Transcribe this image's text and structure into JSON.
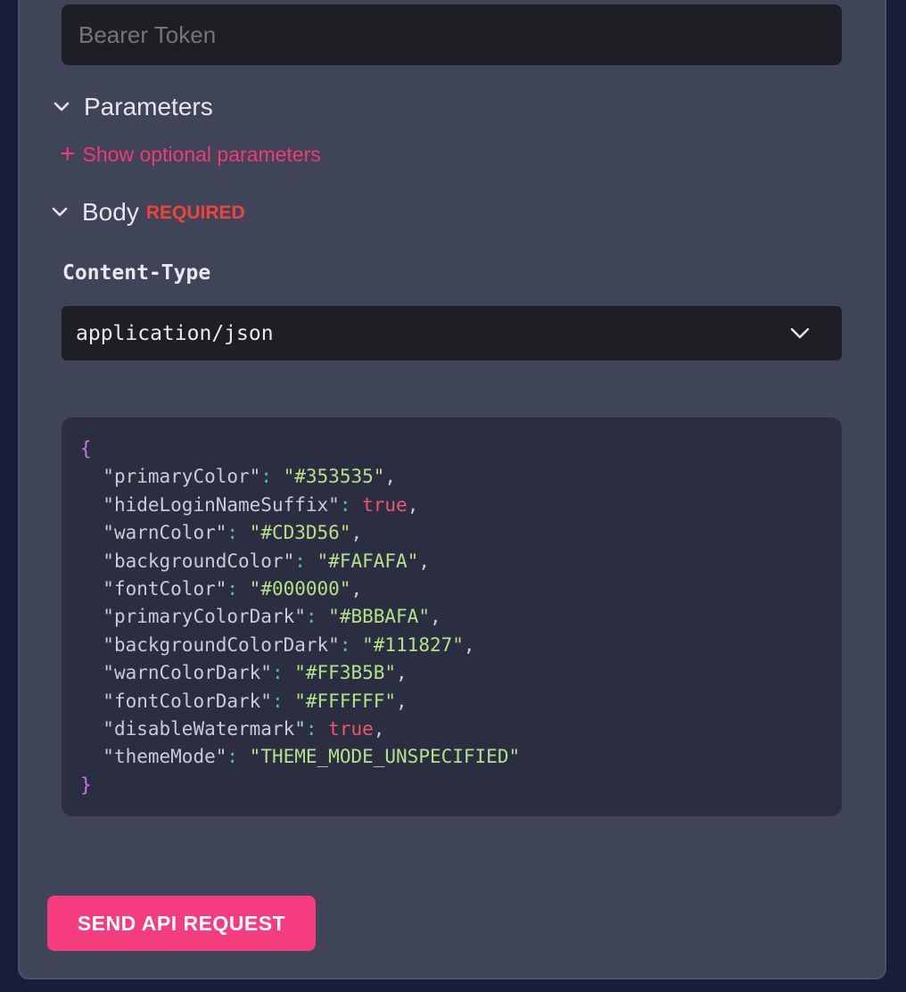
{
  "auth": {
    "token_placeholder": "Bearer Token"
  },
  "parameters": {
    "title": "Parameters",
    "show_optional_label": "Show optional parameters"
  },
  "body": {
    "title": "Body",
    "required_badge": "REQUIRED",
    "content_type_label": "Content-Type",
    "content_type_value": "application/json",
    "open_brace": "{",
    "close_brace": "}",
    "json_lines": [
      {
        "key": "\"primaryColor\"",
        "value": "\"#353535\"",
        "value_type": "string",
        "comma": true
      },
      {
        "key": "\"hideLoginNameSuffix\"",
        "value": "true",
        "value_type": "bool",
        "comma": true
      },
      {
        "key": "\"warnColor\"",
        "value": "\"#CD3D56\"",
        "value_type": "string",
        "comma": true
      },
      {
        "key": "\"backgroundColor\"",
        "value": "\"#FAFAFA\"",
        "value_type": "string",
        "comma": true
      },
      {
        "key": "\"fontColor\"",
        "value": "\"#000000\"",
        "value_type": "string",
        "comma": true
      },
      {
        "key": "\"primaryColorDark\"",
        "value": "\"#BBBAFA\"",
        "value_type": "string",
        "comma": true
      },
      {
        "key": "\"backgroundColorDark\"",
        "value": "\"#111827\"",
        "value_type": "string",
        "comma": true
      },
      {
        "key": "\"warnColorDark\"",
        "value": "\"#FF3B5B\"",
        "value_type": "string",
        "comma": true
      },
      {
        "key": "\"fontColorDark\"",
        "value": "\"#FFFFFF\"",
        "value_type": "string",
        "comma": true
      },
      {
        "key": "\"disableWatermark\"",
        "value": "true",
        "value_type": "bool",
        "comma": true
      },
      {
        "key": "\"themeMode\"",
        "value": "\"THEME_MODE_UNSPECIFIED\"",
        "value_type": "string",
        "comma": false
      }
    ]
  },
  "actions": {
    "send_label": "SEND API REQUEST"
  },
  "colors": {
    "accent": "#f53c7e",
    "required": "#f0443b",
    "panel": "#3f4459",
    "input_bg": "#1e1f24"
  },
  "icons": {
    "chevron": "chevron-down-icon",
    "plus": "plus-icon"
  }
}
